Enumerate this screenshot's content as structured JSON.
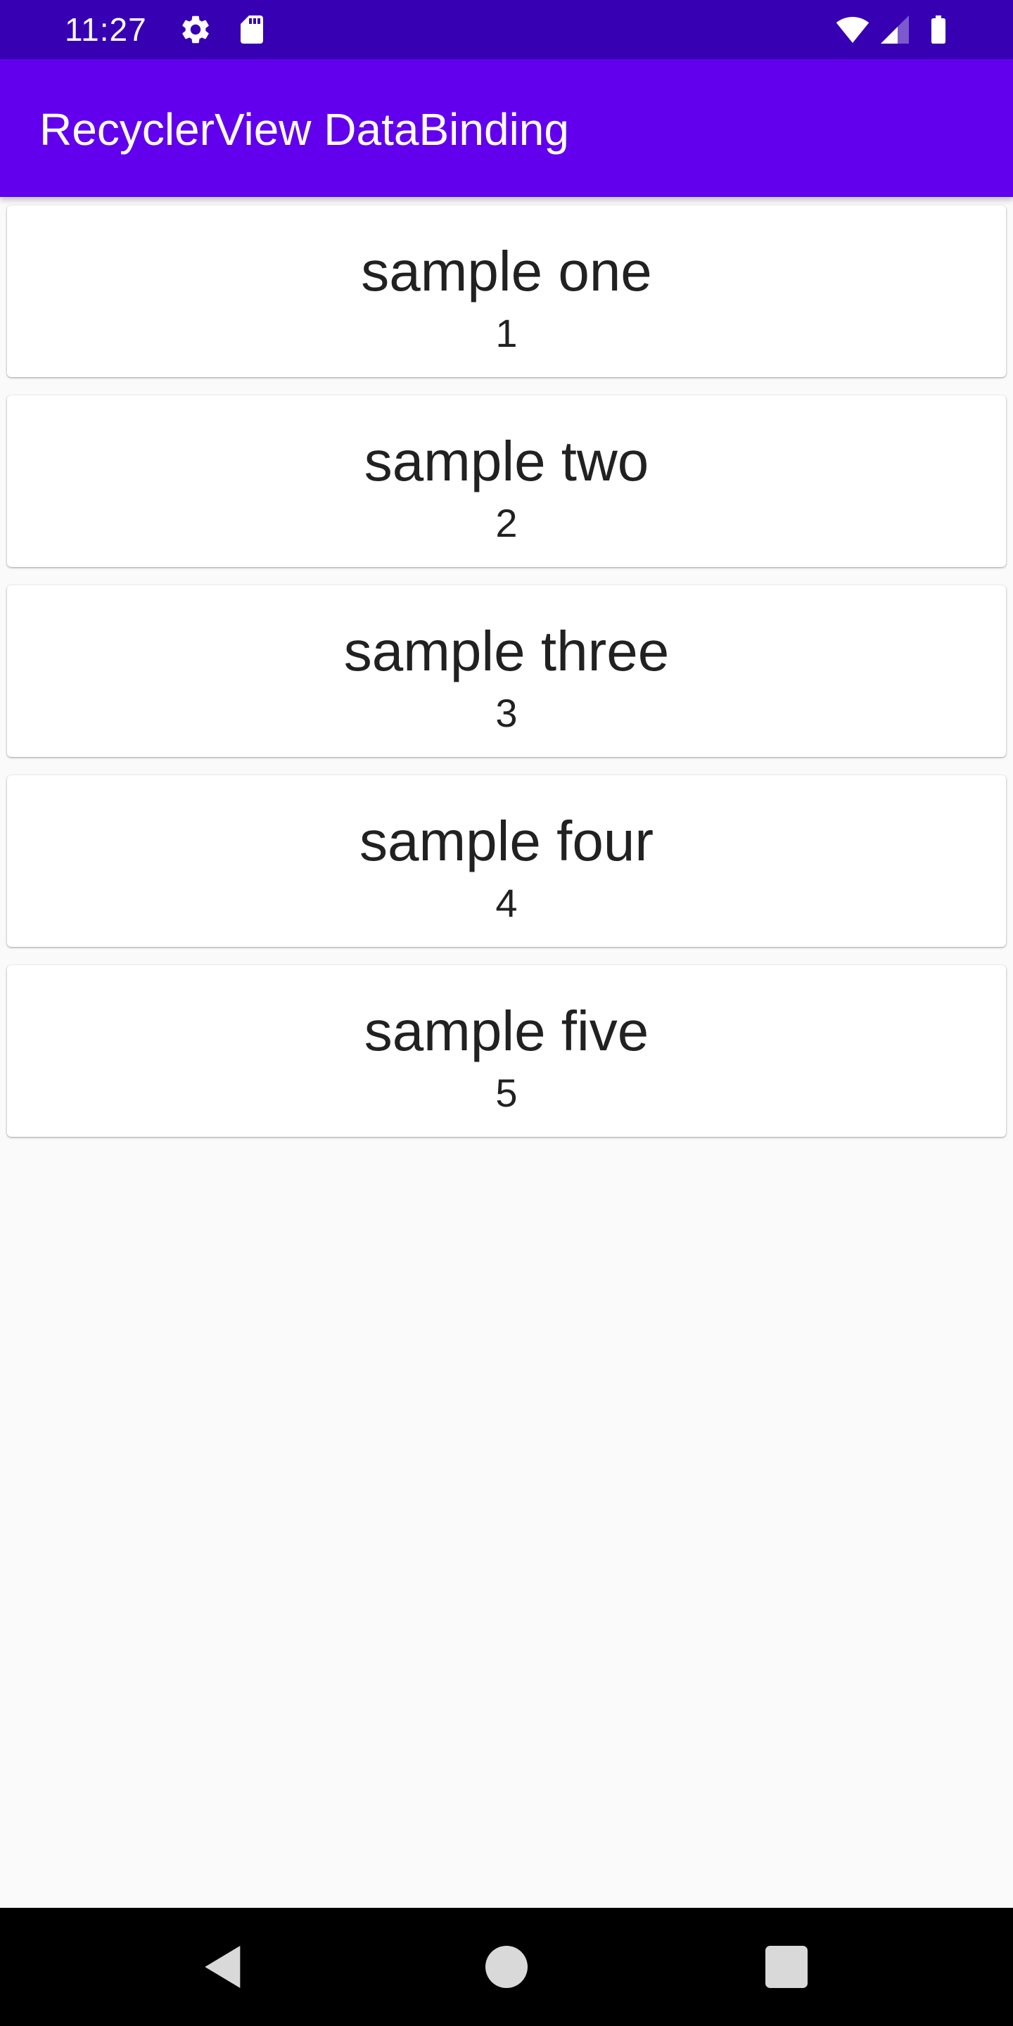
{
  "status_bar": {
    "time": "11:27",
    "icons": [
      "settings-icon",
      "sd-card-icon",
      "wifi-icon",
      "cell-signal-icon",
      "battery-icon"
    ]
  },
  "app_bar": {
    "title": "RecyclerView DataBinding",
    "color": "#6200ee"
  },
  "list": {
    "items": [
      {
        "name": "sample one",
        "number": "1"
      },
      {
        "name": "sample two",
        "number": "2"
      },
      {
        "name": "sample three",
        "number": "3"
      },
      {
        "name": "sample four",
        "number": "4"
      },
      {
        "name": "sample five",
        "number": "5"
      }
    ]
  },
  "nav_bar": {
    "icons": [
      "back-icon",
      "home-icon",
      "recents-icon"
    ]
  },
  "colors": {
    "status_bar": "#3700b3",
    "app_bar": "#6200ee",
    "background": "#fafafa",
    "card": "#ffffff",
    "text": "#212121"
  }
}
